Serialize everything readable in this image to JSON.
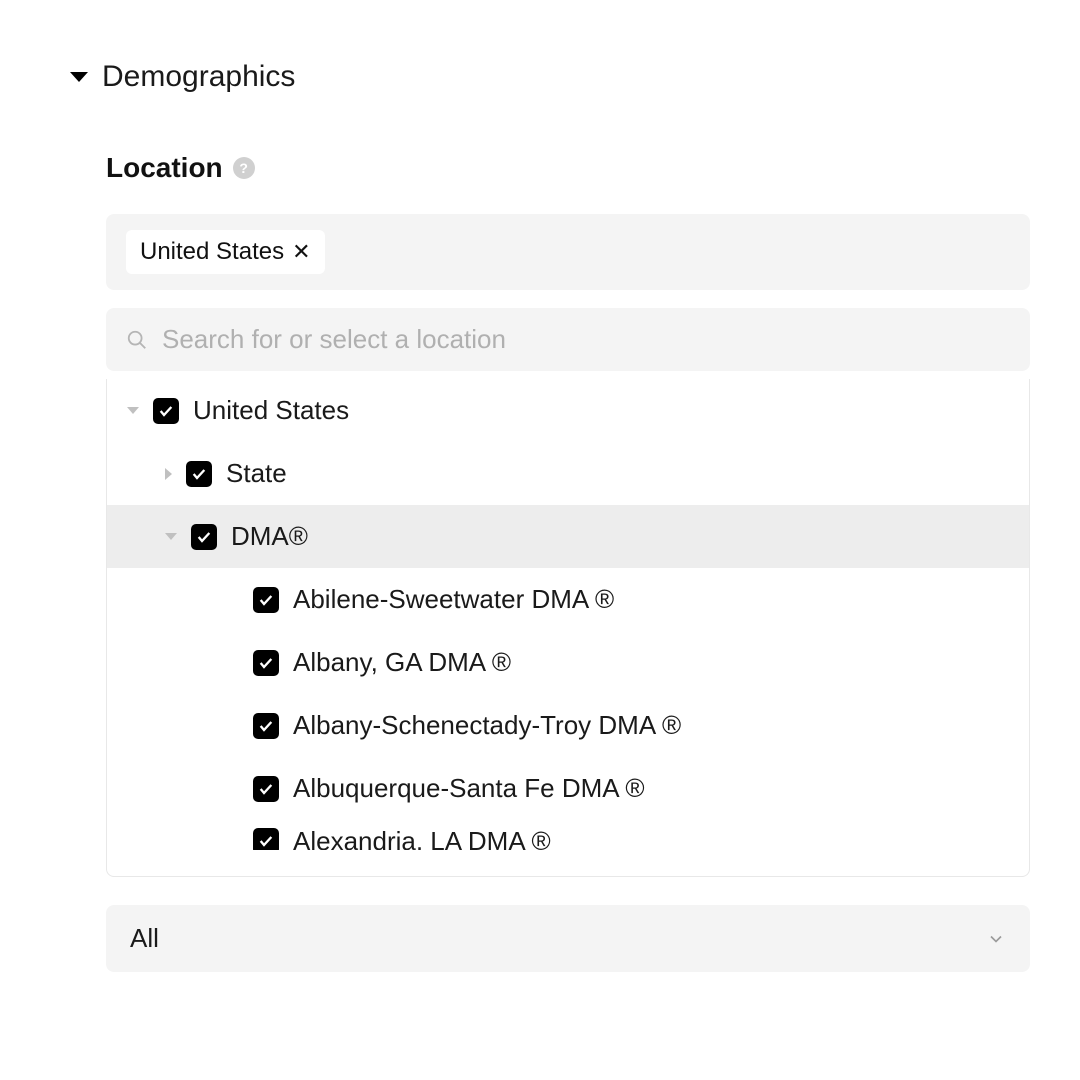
{
  "section": {
    "title": "Demographics"
  },
  "location": {
    "label": "Location",
    "chips": [
      {
        "label": "United States"
      }
    ],
    "search_placeholder": "Search for or select a location",
    "tree": {
      "root": {
        "label": "United States",
        "checked": true
      },
      "children": [
        {
          "label": "State",
          "checked": true,
          "expanded": false
        },
        {
          "label": "DMA®",
          "checked": true,
          "expanded": true,
          "highlighted": true,
          "items": [
            {
              "label": "Abilene-Sweetwater DMA ®",
              "checked": true
            },
            {
              "label": "Albany, GA DMA ®",
              "checked": true
            },
            {
              "label": "Albany-Schenectady-Troy DMA ®",
              "checked": true
            },
            {
              "label": "Albuquerque-Santa Fe DMA ®",
              "checked": true
            },
            {
              "label": "Alexandria, LA DMA ®",
              "checked": true
            }
          ]
        }
      ]
    },
    "dropdown_value": "All"
  }
}
